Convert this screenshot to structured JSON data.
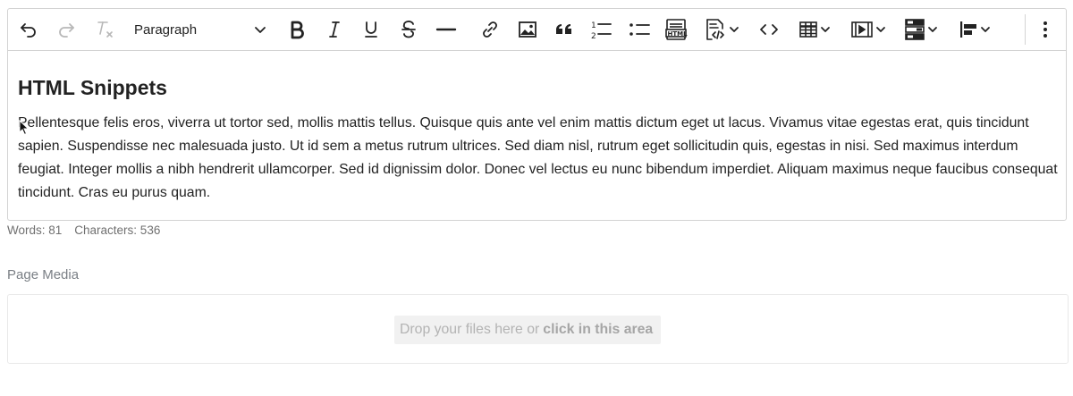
{
  "toolbar": {
    "format_value": "Paragraph",
    "buttons": [
      {
        "name": "undo-button",
        "icon": "undo-icon"
      },
      {
        "name": "redo-button",
        "icon": "redo-icon",
        "disabled": true
      },
      {
        "name": "clear-formatting-button",
        "icon": "clear-formatting-icon"
      },
      {
        "name": "bold-button",
        "icon": "bold-icon"
      },
      {
        "name": "italic-button",
        "icon": "italic-icon"
      },
      {
        "name": "underline-button",
        "icon": "underline-icon"
      },
      {
        "name": "strikethrough-button",
        "icon": "strikethrough-icon"
      },
      {
        "name": "horizontal-line-button",
        "icon": "horizontal-line-icon"
      },
      {
        "name": "link-button",
        "icon": "link-icon"
      },
      {
        "name": "image-button",
        "icon": "image-icon"
      },
      {
        "name": "blockquote-button",
        "icon": "blockquote-icon"
      },
      {
        "name": "numbered-list-button",
        "icon": "numbered-list-icon"
      },
      {
        "name": "bulleted-list-button",
        "icon": "bulleted-list-icon"
      },
      {
        "name": "html-embed-button",
        "icon": "html-icon"
      },
      {
        "name": "snippets-button",
        "icon": "code-snippet-icon"
      },
      {
        "name": "code-button",
        "icon": "code-icon"
      },
      {
        "name": "table-button",
        "icon": "table-icon"
      },
      {
        "name": "media-button",
        "icon": "media-icon"
      },
      {
        "name": "layout-button",
        "icon": "layout-icon"
      },
      {
        "name": "align-button",
        "icon": "align-left-icon"
      },
      {
        "name": "more-button",
        "icon": "more-vertical-icon"
      }
    ]
  },
  "document": {
    "heading": "HTML Snippets",
    "paragraph": "Pellentesque felis eros, viverra ut tortor sed, mollis mattis tellus. Quisque quis ante vel enim mattis dictum eget ut lacus. Vivamus vitae egestas erat, quis tincidunt sapien. Suspendisse nec malesuada justo. Ut id sem a metus rutrum ultrices. Sed diam nisl, rutrum eget sollicitudin quis, egestas in nisi. Sed maximus interdum feugiat. Integer mollis a nibh hendrerit ullamcorper. Sed id dignissim dolor. Donec vel lectus eu nunc bibendum imperdiet. Aliquam maximus neque faucibus consequat tincidunt. Cras eu purus quam."
  },
  "status": {
    "words": "Words: 81",
    "characters": "Characters: 536"
  },
  "media": {
    "label": "Page Media",
    "drop_text": "Drop your files here or",
    "drop_link": "click in this area"
  },
  "colors": {
    "border": "#d3d3d3",
    "text": "#222222",
    "muted": "#707070",
    "disabled_icon": "#b8b8b8"
  }
}
